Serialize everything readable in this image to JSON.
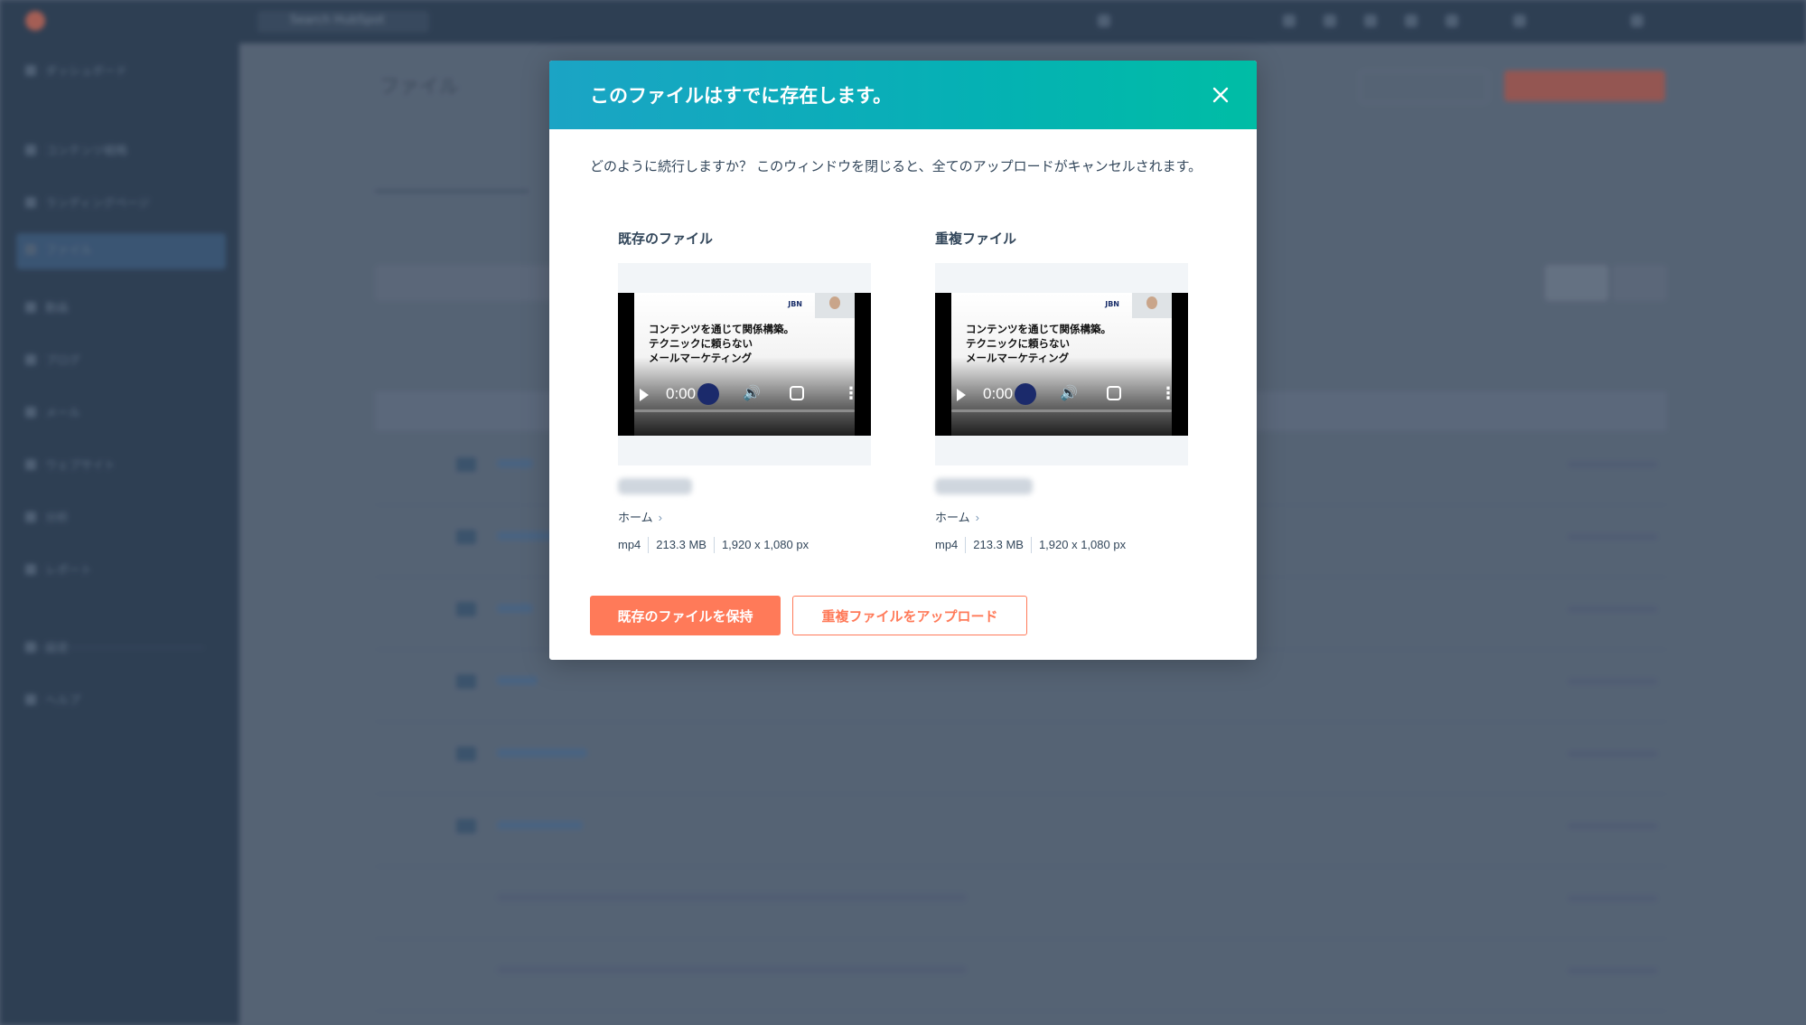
{
  "background": {
    "search_placeholder": "Search HubSpot",
    "page_title": "ファイル",
    "sidebar_items": [
      "ダッシュボード",
      "コンテンツ戦略",
      "ランディングページ",
      "ファイル",
      "動画",
      "ブログ",
      "メール",
      "ウェブサイト",
      "分析",
      "レポート",
      "設定",
      "ヘルプ"
    ]
  },
  "modal": {
    "title": "このファイルはすでに存在します。",
    "description": "どのように続行しますか？ このウィンドウを閉じると、全てのアップロードがキャンセルされます。",
    "existing": {
      "heading": "既存のファイル",
      "breadcrumb": "ホーム",
      "meta": {
        "type": "mp4",
        "size": "213.3 MB",
        "dimensions": "1,920 x 1,080 px"
      },
      "video": {
        "slide_lines": [
          "コンテンツを通じて関係構築。",
          "テクニックに頼らない",
          "メールマーケティング"
        ],
        "logo_text": "JBN",
        "time": "0:00"
      }
    },
    "duplicate": {
      "heading": "重複ファイル",
      "breadcrumb": "ホーム",
      "meta": {
        "type": "mp4",
        "size": "213.3 MB",
        "dimensions": "1,920 x 1,080 px"
      },
      "video": {
        "slide_lines": [
          "コンテンツを通じて関係構築。",
          "テクニックに頼らない",
          "メールマーケティング"
        ],
        "logo_text": "JBN",
        "time": "0:00"
      }
    },
    "buttons": {
      "keep_label": "既存のファイルを保持",
      "upload_label": "重複ファイルをアップロード"
    }
  },
  "colors": {
    "accent": "#ff7a59",
    "header_gradient_start": "#1ba4c5",
    "header_gradient_end": "#00bda5",
    "text": "#33475b"
  }
}
